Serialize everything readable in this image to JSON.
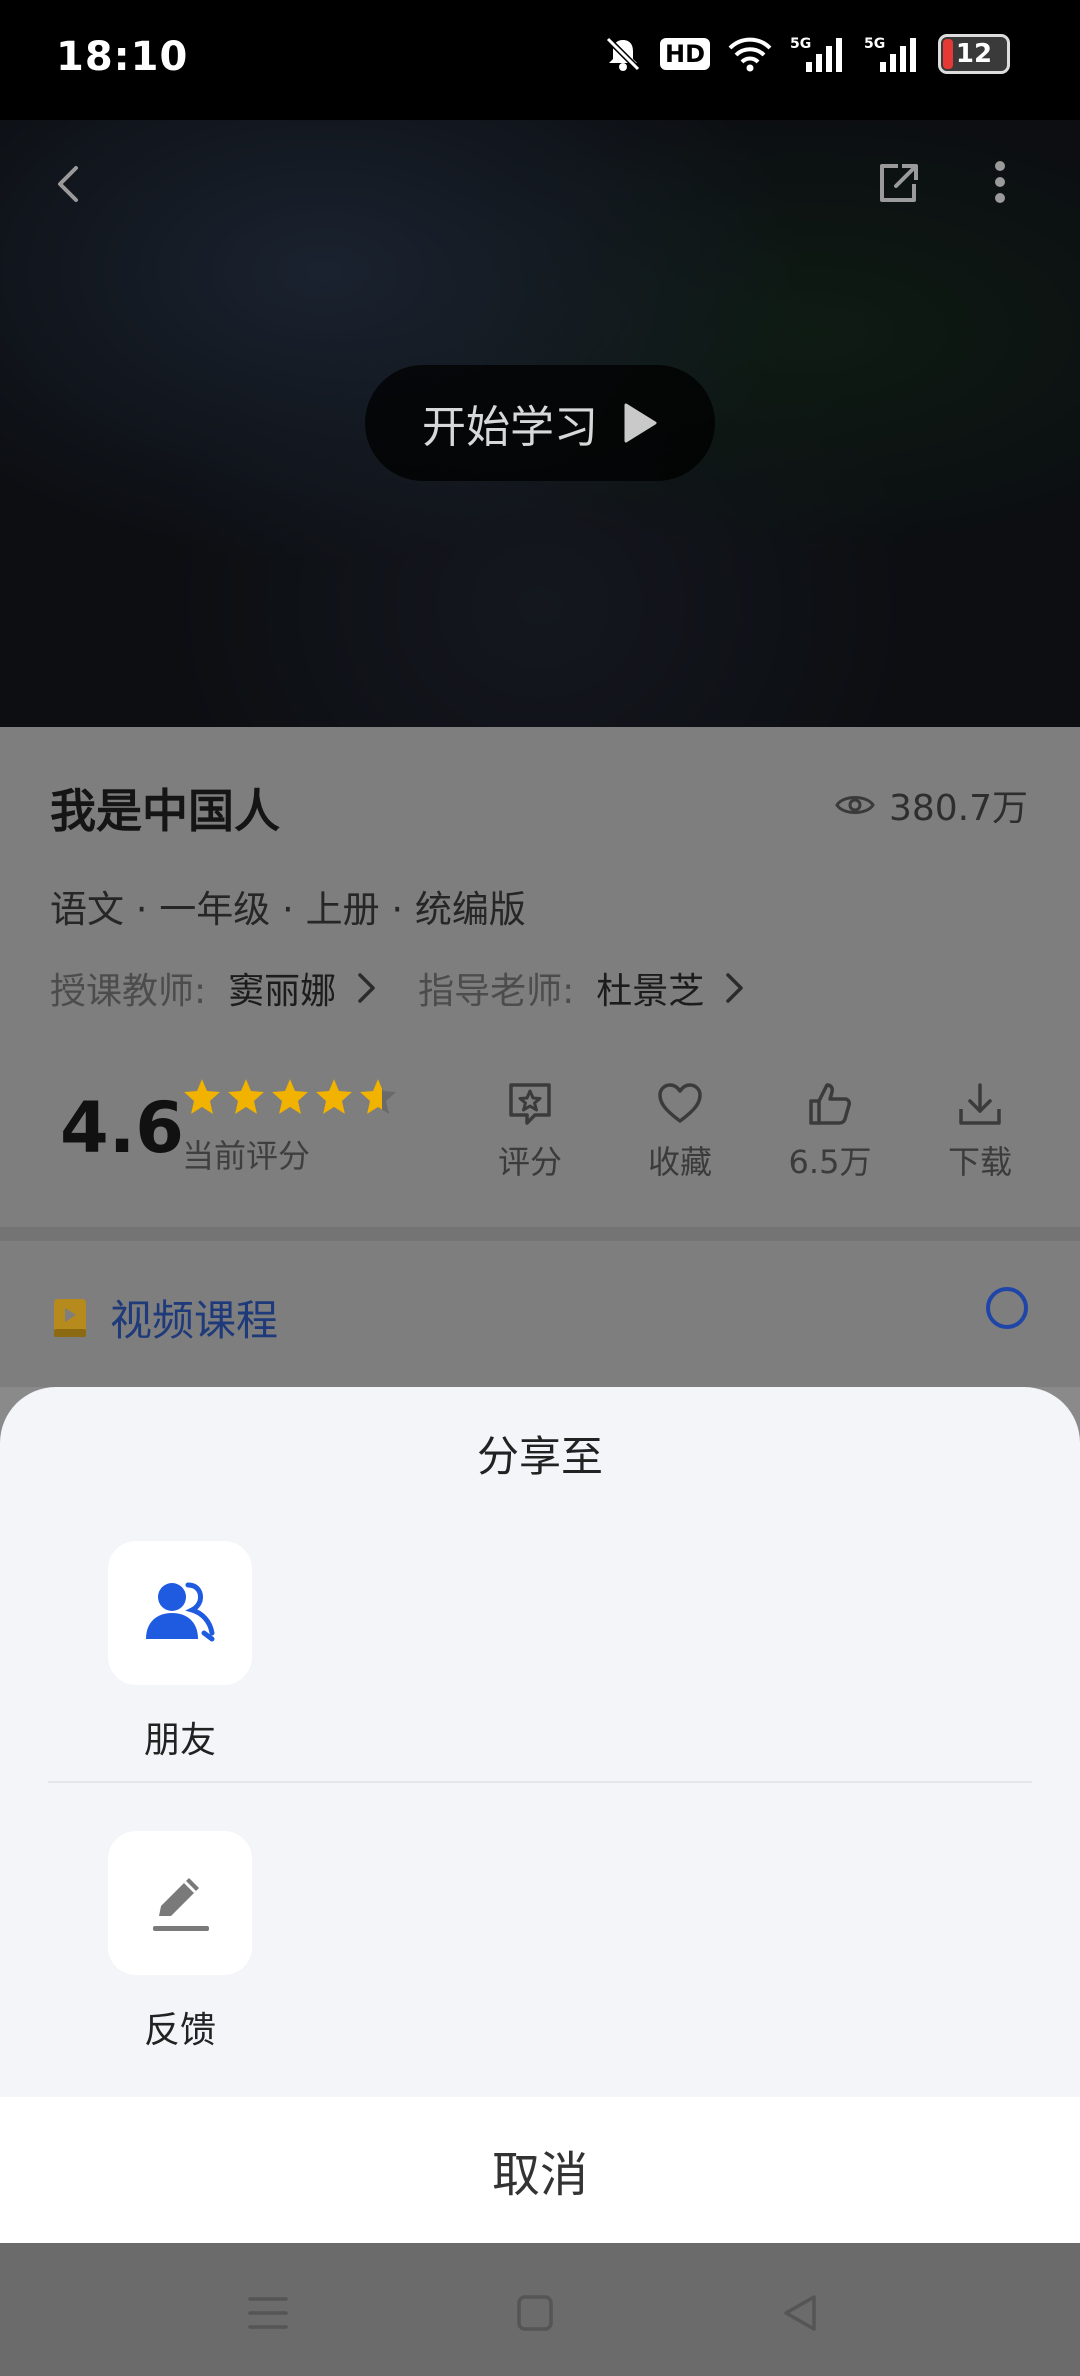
{
  "status_bar": {
    "time": "18:10",
    "icons": [
      "mute-bell-icon",
      "hd-icon",
      "wifi-icon",
      "5g-signal-icon",
      "5g-signal-icon",
      "battery-icon"
    ],
    "hd_label": "HD",
    "signal_label": "5G",
    "battery_level": "12"
  },
  "video": {
    "start_label": "开始学习"
  },
  "course": {
    "title": "我是中国人",
    "views": "380.7万",
    "subject_line": "语文 · 一年级 · 上册 · 统编版",
    "teacher_label": "授课教师:",
    "teacher_name": "窦丽娜",
    "advisor_label": "指导老师:",
    "advisor_name": "杜景芝",
    "score": "4.6",
    "score_label": "当前评分",
    "stars_value": 4.6,
    "actions": [
      {
        "label": "评分",
        "icon": "rate-star-icon"
      },
      {
        "label": "收藏",
        "icon": "heart-icon"
      },
      {
        "label": "6.5万",
        "icon": "thumbs-up-icon"
      },
      {
        "label": "下载",
        "icon": "download-icon"
      }
    ],
    "video_section_label": "视频课程"
  },
  "share_sheet": {
    "title": "分享至",
    "items": [
      {
        "label": "朋友",
        "icon": "friends-icon"
      },
      {
        "label": "反馈",
        "icon": "edit-pencil-icon"
      }
    ],
    "cancel_label": "取消"
  },
  "colors": {
    "accent_blue": "#1e5be0",
    "star_gold": "#f2b200"
  }
}
